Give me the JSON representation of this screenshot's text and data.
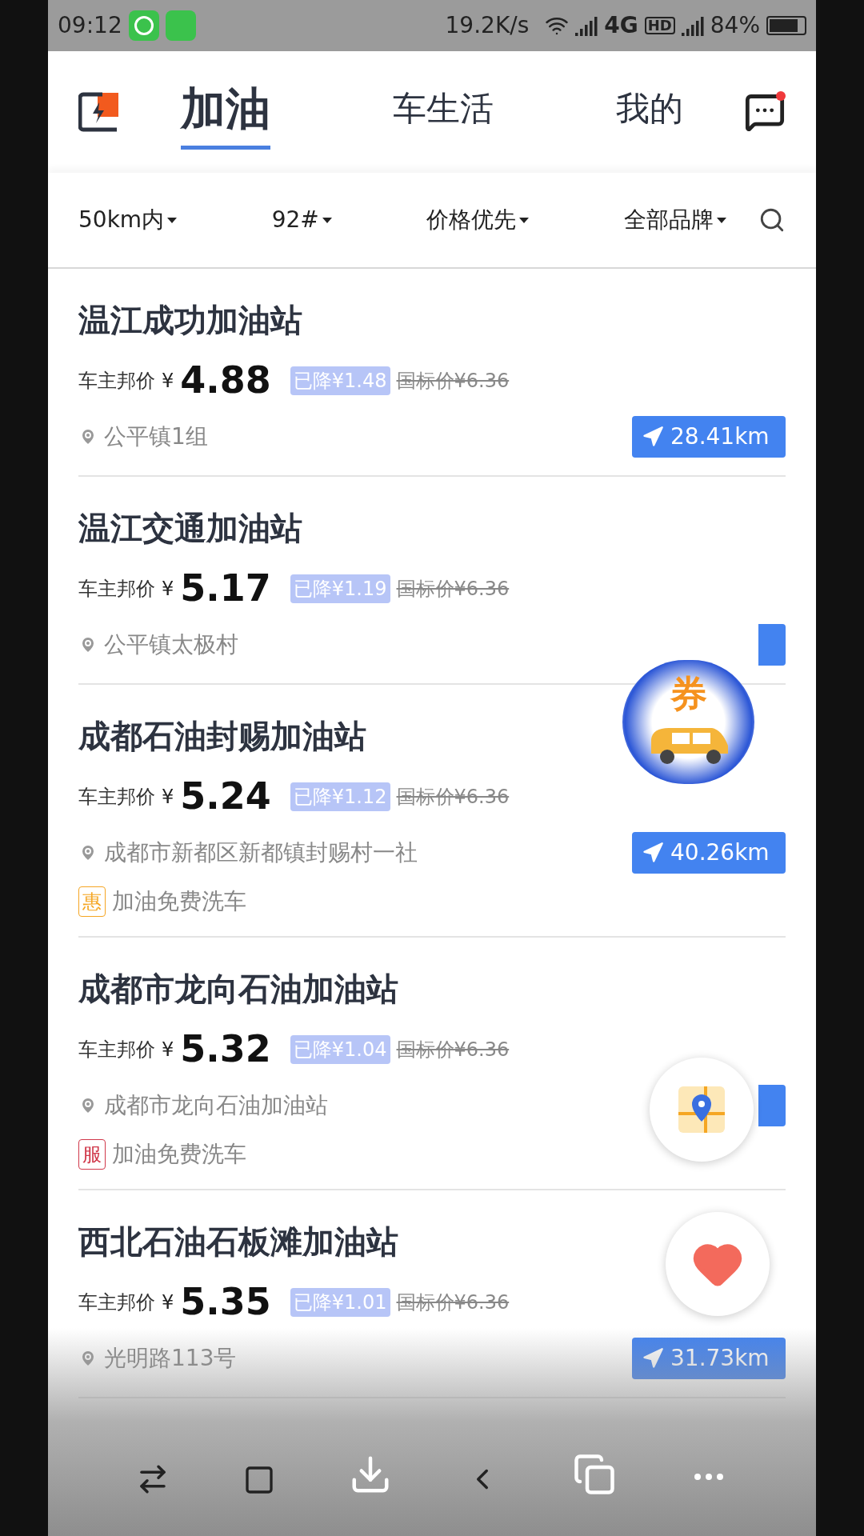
{
  "status_bar": {
    "time": "09:12",
    "speed": "19.2K/s",
    "network": "4G",
    "hd": "HD",
    "battery": "84%"
  },
  "header": {
    "tabs": [
      {
        "label": "加油",
        "selected": true
      },
      {
        "label": "车生活",
        "selected": false
      },
      {
        "label": "我的",
        "selected": false
      }
    ],
    "messages_unread": true
  },
  "filters": [
    {
      "label": "50km内"
    },
    {
      "label": "92#"
    },
    {
      "label": "价格优先"
    },
    {
      "label": "全部品牌"
    }
  ],
  "stations": [
    {
      "name": "温江成功加油站",
      "price_label": "车主邦价",
      "currency": "¥",
      "price": "4.88",
      "discount": "已降¥1.48",
      "standard_price": "国标价¥6.36",
      "address": "公平镇1组",
      "distance": "28.41km"
    },
    {
      "name": "温江交通加油站",
      "price_label": "车主邦价",
      "currency": "¥",
      "price": "5.17",
      "discount": "已降¥1.19",
      "standard_price": "国标价¥6.36",
      "address": "公平镇太极村"
    },
    {
      "name": "成都石油封赐加油站",
      "price_label": "车主邦价",
      "currency": "¥",
      "price": "5.24",
      "discount": "已降¥1.12",
      "standard_price": "国标价¥6.36",
      "address": "成都市新都区新都镇封赐村一社",
      "distance": "40.26km",
      "promo": {
        "tag": "惠",
        "color": "#f5a623",
        "text": "加油免费洗车"
      }
    },
    {
      "name": "成都市龙向石油加油站",
      "price_label": "车主邦价",
      "currency": "¥",
      "price": "5.32",
      "discount": "已降¥1.04",
      "standard_price": "国标价¥6.36",
      "address": "成都市龙向石油加油站",
      "promo": {
        "tag": "服",
        "color": "#d0384a",
        "text": "加油免费洗车"
      }
    },
    {
      "name": "西北石油石板滩加油站",
      "price_label": "车主邦价",
      "currency": "¥",
      "price": "5.35",
      "discount": "已降¥1.01",
      "standard_price": "国标价¥6.36",
      "address": "光明路113号",
      "distance": "31.73km"
    }
  ],
  "floating": {
    "coupon_label": "券"
  }
}
